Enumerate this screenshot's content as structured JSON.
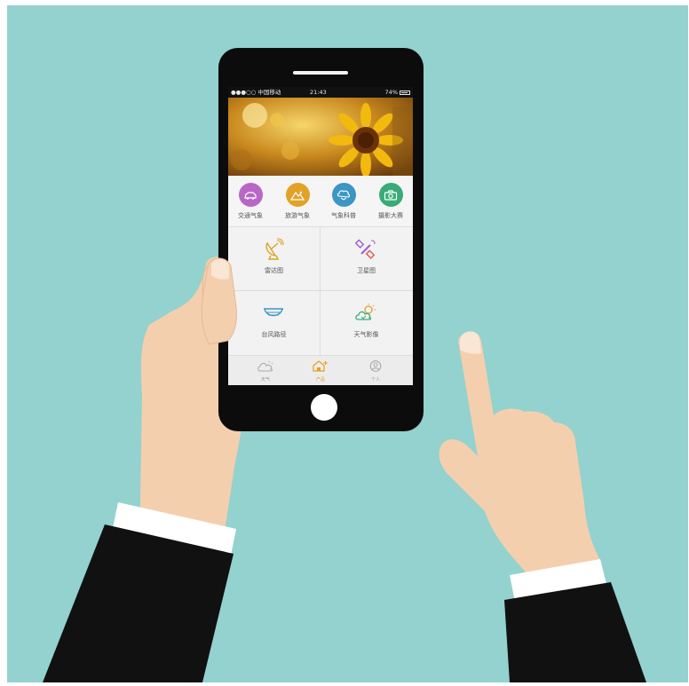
{
  "status_bar": {
    "carrier": "●●●○○ 中国移动",
    "time": "21:43",
    "battery": "74%"
  },
  "categories": [
    {
      "label": "交通气象",
      "icon": "car-icon",
      "color": "#b867c7"
    },
    {
      "label": "旅游气象",
      "icon": "mountain-icon",
      "color": "#e2a228"
    },
    {
      "label": "气象科普",
      "icon": "cloud-book-icon",
      "color": "#3c95c2"
    },
    {
      "label": "摄影大赛",
      "icon": "camera-icon",
      "color": "#3aab78"
    }
  ],
  "tiles": [
    {
      "label": "雷达图",
      "icon": "radar-dish-icon"
    },
    {
      "label": "卫星图",
      "icon": "satellite-icon"
    },
    {
      "label": "台风路径",
      "icon": "typhoon-icon"
    },
    {
      "label": "天气影像",
      "icon": "weather-image-icon"
    }
  ],
  "tabs": [
    {
      "label": "天气",
      "icon": "weather-tab-icon",
      "active": false
    },
    {
      "label": "产品",
      "icon": "product-tab-icon",
      "active": true
    },
    {
      "label": "个人",
      "icon": "person-tab-icon",
      "active": false
    }
  ],
  "colors": {
    "background": "#93d2ce",
    "accent": "#e6a020"
  }
}
